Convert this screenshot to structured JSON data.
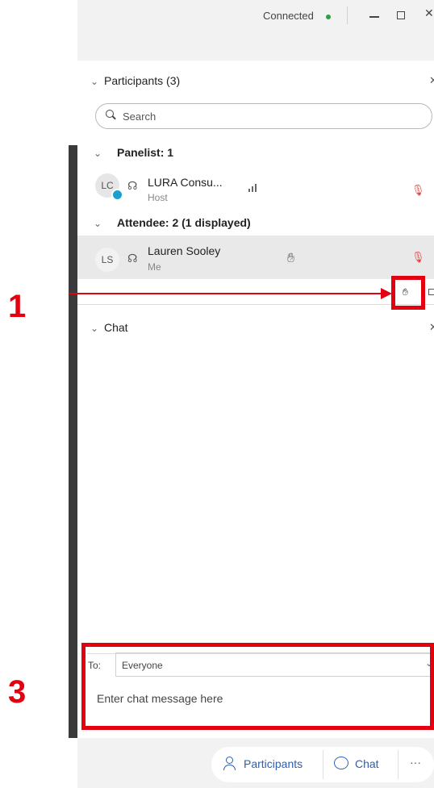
{
  "title_bar": {
    "status": "Connected",
    "status_color": "#2aa043",
    "controls": [
      "minimize-icon",
      "restore-icon",
      "close-icon"
    ]
  },
  "participants": {
    "header": "Participants (3)",
    "search_placeholder": "Search",
    "panelist_group": "Panelist: 1",
    "attendee_group": "Attendee: 2 (1 displayed)",
    "host": {
      "initials": "LC",
      "name": "LURA Consu...",
      "role": "Host"
    },
    "me": {
      "initials": "LS",
      "name": "Lauren Sooley",
      "role": "Me"
    }
  },
  "chat": {
    "header": "Chat",
    "to_label": "To:",
    "to_value": "Everyone",
    "input_placeholder": "Enter chat message here"
  },
  "toolbar": {
    "participants_label": "Participants",
    "chat_label": "Chat",
    "more_label": "···"
  },
  "callouts": {
    "first": "1",
    "third": "3"
  },
  "colors": {
    "callout": "#e3000f",
    "accent": "#2b5fb3",
    "mute": "#e04848"
  }
}
